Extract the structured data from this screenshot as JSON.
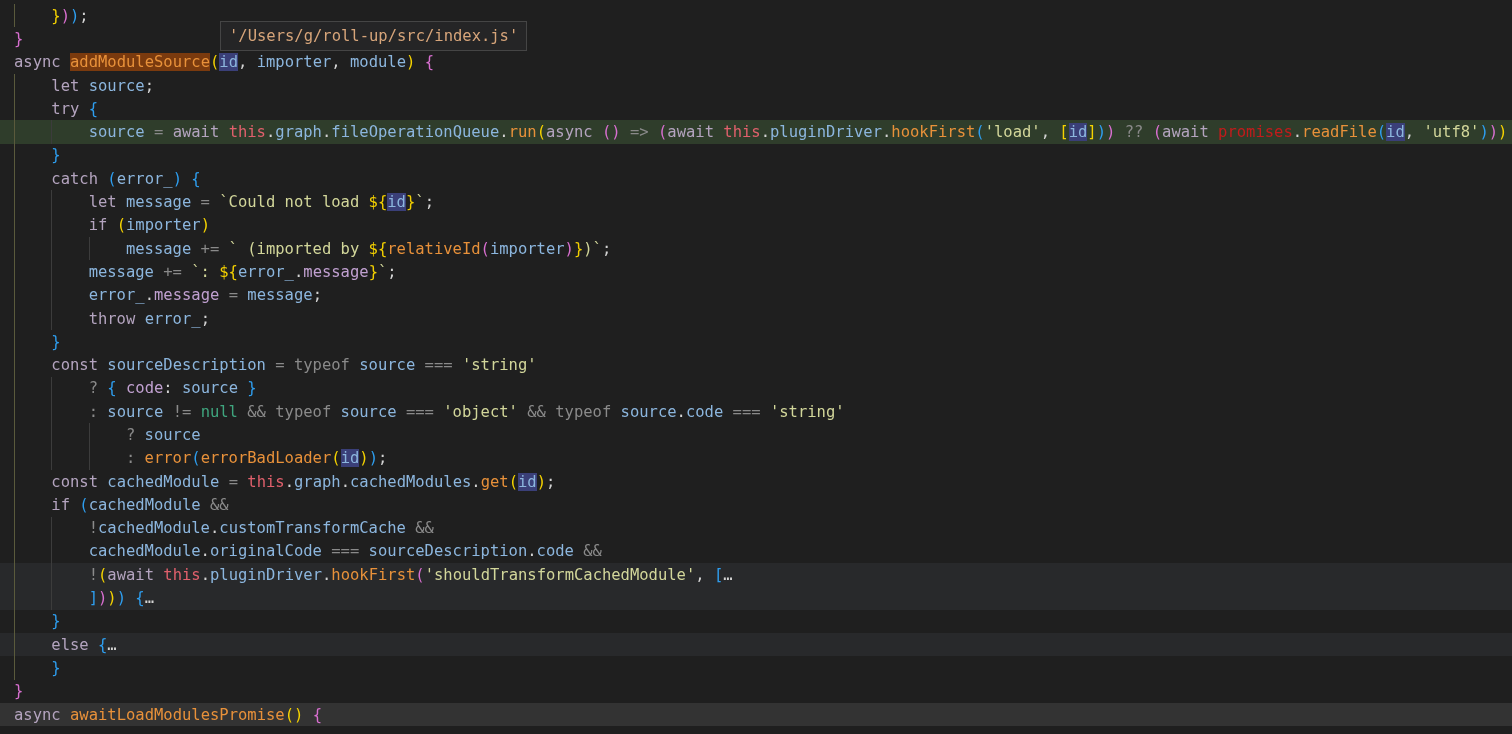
{
  "editor": {
    "tooltip": "'/Users/g/roll-up/src/index.js'",
    "lines": [
      {
        "kind": "normal",
        "tokens": [
          {
            "text": "    }",
            "kind": "p3"
          },
          {
            "text": ")",
            "kind": "p1"
          },
          {
            "text": ")",
            "kind": "p2"
          },
          {
            "text": ";",
            "kind": "punct"
          }
        ]
      },
      {
        "kind": "normal",
        "tokens": [
          {
            "text": "}",
            "kind": "p1"
          }
        ]
      },
      {
        "kind": "normal",
        "tokens": [
          {
            "text": "async ",
            "kind": "kw"
          },
          {
            "text": "addModuleSource",
            "kind": "fn",
            "highlighted": true
          },
          {
            "text": "(",
            "kind": "p3"
          },
          {
            "text": "id",
            "kind": "var",
            "highlighted": true
          },
          {
            "text": ", ",
            "kind": "punct"
          },
          {
            "text": "importer",
            "kind": "var"
          },
          {
            "text": ", ",
            "kind": "punct"
          },
          {
            "text": "module",
            "kind": "var"
          },
          {
            "text": ")",
            "kind": "p3"
          },
          {
            "text": " {",
            "kind": "p1"
          }
        ]
      },
      {
        "kind": "normal",
        "tokens": [
          {
            "text": "    let ",
            "kind": "kw"
          },
          {
            "text": "source",
            "kind": "var"
          },
          {
            "text": ";",
            "kind": "punct"
          }
        ]
      },
      {
        "kind": "normal",
        "tokens": [
          {
            "text": "    try ",
            "kind": "kw"
          },
          {
            "text": "{",
            "kind": "p2"
          }
        ]
      },
      {
        "kind": "changed",
        "tokens": [
          {
            "text": "        source",
            "kind": "var"
          },
          {
            "text": " = ",
            "kind": "op"
          },
          {
            "text": "await ",
            "kind": "kw"
          },
          {
            "text": "this",
            "kind": "this"
          },
          {
            "text": ".",
            "kind": "punct"
          },
          {
            "text": "graph",
            "kind": "var"
          },
          {
            "text": ".",
            "kind": "punct"
          },
          {
            "text": "fileOperationQueue",
            "kind": "var"
          },
          {
            "text": ".",
            "kind": "punct"
          },
          {
            "text": "run",
            "kind": "fn"
          },
          {
            "text": "(",
            "kind": "p3"
          },
          {
            "text": "async ",
            "kind": "kw"
          },
          {
            "text": "()",
            "kind": "p1"
          },
          {
            "text": " => ",
            "kind": "op"
          },
          {
            "text": "(",
            "kind": "p1"
          },
          {
            "text": "await ",
            "kind": "kw"
          },
          {
            "text": "this",
            "kind": "this"
          },
          {
            "text": ".",
            "kind": "punct"
          },
          {
            "text": "pluginDriver",
            "kind": "var"
          },
          {
            "text": ".",
            "kind": "punct"
          },
          {
            "text": "hookFirst",
            "kind": "fn"
          },
          {
            "text": "(",
            "kind": "p2"
          },
          {
            "text": "'load'",
            "kind": "str"
          },
          {
            "text": ", ",
            "kind": "punct"
          },
          {
            "text": "[",
            "kind": "p3"
          },
          {
            "text": "id",
            "kind": "var",
            "highlighted": true
          },
          {
            "text": "]",
            "kind": "p3"
          },
          {
            "text": ")",
            "kind": "p2"
          },
          {
            "text": ")",
            "kind": "p1"
          },
          {
            "text": " ?? ",
            "kind": "op"
          },
          {
            "text": "(",
            "kind": "p1"
          },
          {
            "text": "await ",
            "kind": "kw"
          },
          {
            "text": "promises",
            "kind": "global"
          },
          {
            "text": ".",
            "kind": "punct"
          },
          {
            "text": "readFile",
            "kind": "fn"
          },
          {
            "text": "(",
            "kind": "p2"
          },
          {
            "text": "id",
            "kind": "var",
            "highlighted": true
          },
          {
            "text": ", ",
            "kind": "punct"
          },
          {
            "text": "'utf8'",
            "kind": "str"
          },
          {
            "text": ")",
            "kind": "p2"
          },
          {
            "text": ")",
            "kind": "p1"
          },
          {
            "text": ")",
            "kind": "p3"
          }
        ]
      },
      {
        "kind": "normal",
        "tokens": [
          {
            "text": "    }",
            "kind": "p2"
          }
        ]
      },
      {
        "kind": "normal",
        "tokens": [
          {
            "text": "    catch ",
            "kind": "kw"
          },
          {
            "text": "(",
            "kind": "p2"
          },
          {
            "text": "error_",
            "kind": "var"
          },
          {
            "text": ")",
            "kind": "p2"
          },
          {
            "text": " {",
            "kind": "p2"
          }
        ]
      },
      {
        "kind": "normal",
        "tokens": [
          {
            "text": "        let ",
            "kind": "kw"
          },
          {
            "text": "message",
            "kind": "var"
          },
          {
            "text": " = ",
            "kind": "op"
          },
          {
            "text": "`Could not load ",
            "kind": "str"
          },
          {
            "text": "${",
            "kind": "tpl"
          },
          {
            "text": "id",
            "kind": "var",
            "highlighted": true
          },
          {
            "text": "}",
            "kind": "tpl"
          },
          {
            "text": "`",
            "kind": "str"
          },
          {
            "text": ";",
            "kind": "punct"
          }
        ]
      },
      {
        "kind": "normal",
        "tokens": [
          {
            "text": "        if ",
            "kind": "kw"
          },
          {
            "text": "(",
            "kind": "p3"
          },
          {
            "text": "importer",
            "kind": "var"
          },
          {
            "text": ")",
            "kind": "p3"
          }
        ]
      },
      {
        "kind": "normal",
        "tokens": [
          {
            "text": "            message",
            "kind": "var"
          },
          {
            "text": " += ",
            "kind": "op"
          },
          {
            "text": "` (imported by ",
            "kind": "str"
          },
          {
            "text": "${",
            "kind": "tpl"
          },
          {
            "text": "relativeId",
            "kind": "fn"
          },
          {
            "text": "(",
            "kind": "p1"
          },
          {
            "text": "importer",
            "kind": "var"
          },
          {
            "text": ")",
            "kind": "p1"
          },
          {
            "text": "}",
            "kind": "tpl"
          },
          {
            "text": ")`",
            "kind": "str"
          },
          {
            "text": ";",
            "kind": "punct"
          }
        ]
      },
      {
        "kind": "normal",
        "tokens": [
          {
            "text": "        message",
            "kind": "var"
          },
          {
            "text": " += ",
            "kind": "op"
          },
          {
            "text": "`: ",
            "kind": "str"
          },
          {
            "text": "${",
            "kind": "tpl"
          },
          {
            "text": "error_",
            "kind": "var"
          },
          {
            "text": ".",
            "kind": "punct"
          },
          {
            "text": "message",
            "kind": "prop"
          },
          {
            "text": "}",
            "kind": "tpl"
          },
          {
            "text": "`",
            "kind": "str"
          },
          {
            "text": ";",
            "kind": "punct"
          }
        ]
      },
      {
        "kind": "normal",
        "tokens": [
          {
            "text": "        error_",
            "kind": "var"
          },
          {
            "text": ".",
            "kind": "punct"
          },
          {
            "text": "message",
            "kind": "prop"
          },
          {
            "text": " = ",
            "kind": "op"
          },
          {
            "text": "message",
            "kind": "var"
          },
          {
            "text": ";",
            "kind": "punct"
          }
        ]
      },
      {
        "kind": "normal",
        "tokens": [
          {
            "text": "        throw ",
            "kind": "kw"
          },
          {
            "text": "error_",
            "kind": "var"
          },
          {
            "text": ";",
            "kind": "punct"
          }
        ]
      },
      {
        "kind": "normal",
        "tokens": [
          {
            "text": "    }",
            "kind": "p2"
          }
        ]
      },
      {
        "kind": "normal",
        "tokens": [
          {
            "text": "    const ",
            "kind": "kw"
          },
          {
            "text": "sourceDescription",
            "kind": "var"
          },
          {
            "text": " = typeof ",
            "kind": "op"
          },
          {
            "text": "source",
            "kind": "var"
          },
          {
            "text": " === ",
            "kind": "op"
          },
          {
            "text": "'string'",
            "kind": "str"
          }
        ]
      },
      {
        "kind": "normal",
        "tokens": [
          {
            "text": "        ? ",
            "kind": "op"
          },
          {
            "text": "{ ",
            "kind": "p2"
          },
          {
            "text": "code",
            "kind": "prop"
          },
          {
            "text": ": ",
            "kind": "punct"
          },
          {
            "text": "source",
            "kind": "var"
          },
          {
            "text": " }",
            "kind": "p2"
          }
        ]
      },
      {
        "kind": "normal",
        "tokens": [
          {
            "text": "        : ",
            "kind": "op"
          },
          {
            "text": "source",
            "kind": "var"
          },
          {
            "text": " != ",
            "kind": "op"
          },
          {
            "text": "null",
            "kind": "null"
          },
          {
            "text": " && typeof ",
            "kind": "op"
          },
          {
            "text": "source",
            "kind": "var"
          },
          {
            "text": " === ",
            "kind": "op"
          },
          {
            "text": "'object'",
            "kind": "str"
          },
          {
            "text": " && typeof ",
            "kind": "op"
          },
          {
            "text": "source",
            "kind": "var"
          },
          {
            "text": ".",
            "kind": "punct"
          },
          {
            "text": "code",
            "kind": "var"
          },
          {
            "text": " === ",
            "kind": "op"
          },
          {
            "text": "'string'",
            "kind": "str"
          }
        ]
      },
      {
        "kind": "normal",
        "tokens": [
          {
            "text": "            ? ",
            "kind": "op"
          },
          {
            "text": "source",
            "kind": "var"
          }
        ]
      },
      {
        "kind": "normal",
        "tokens": [
          {
            "text": "            : ",
            "kind": "op"
          },
          {
            "text": "error",
            "kind": "fn"
          },
          {
            "text": "(",
            "kind": "p2"
          },
          {
            "text": "errorBadLoader",
            "kind": "fn"
          },
          {
            "text": "(",
            "kind": "p3"
          },
          {
            "text": "id",
            "kind": "var",
            "highlighted": true
          },
          {
            "text": ")",
            "kind": "p3"
          },
          {
            "text": ")",
            "kind": "p2"
          },
          {
            "text": ";",
            "kind": "punct"
          }
        ]
      },
      {
        "kind": "normal",
        "tokens": [
          {
            "text": "    const ",
            "kind": "kw"
          },
          {
            "text": "cachedModule",
            "kind": "var"
          },
          {
            "text": " = ",
            "kind": "op"
          },
          {
            "text": "this",
            "kind": "this"
          },
          {
            "text": ".",
            "kind": "punct"
          },
          {
            "text": "graph",
            "kind": "var"
          },
          {
            "text": ".",
            "kind": "punct"
          },
          {
            "text": "cachedModules",
            "kind": "var"
          },
          {
            "text": ".",
            "kind": "punct"
          },
          {
            "text": "get",
            "kind": "fn"
          },
          {
            "text": "(",
            "kind": "p3"
          },
          {
            "text": "id",
            "kind": "var",
            "highlighted": true
          },
          {
            "text": ")",
            "kind": "p3"
          },
          {
            "text": ";",
            "kind": "punct"
          }
        ]
      },
      {
        "kind": "normal",
        "tokens": [
          {
            "text": "    if ",
            "kind": "kw"
          },
          {
            "text": "(",
            "kind": "p2"
          },
          {
            "text": "cachedModule",
            "kind": "var"
          },
          {
            "text": " &&",
            "kind": "op"
          }
        ]
      },
      {
        "kind": "normal",
        "tokens": [
          {
            "text": "        !",
            "kind": "op"
          },
          {
            "text": "cachedModule",
            "kind": "var"
          },
          {
            "text": ".",
            "kind": "punct"
          },
          {
            "text": "customTransformCache",
            "kind": "var"
          },
          {
            "text": " &&",
            "kind": "op"
          }
        ]
      },
      {
        "kind": "normal",
        "tokens": [
          {
            "text": "        cachedModule",
            "kind": "var"
          },
          {
            "text": ".",
            "kind": "punct"
          },
          {
            "text": "originalCode",
            "kind": "var"
          },
          {
            "text": " === ",
            "kind": "op"
          },
          {
            "text": "sourceDescription",
            "kind": "var"
          },
          {
            "text": ".",
            "kind": "punct"
          },
          {
            "text": "code",
            "kind": "var"
          },
          {
            "text": " &&",
            "kind": "op"
          }
        ]
      },
      {
        "kind": "folded",
        "tokens": [
          {
            "text": "        !",
            "kind": "op"
          },
          {
            "text": "(",
            "kind": "p3"
          },
          {
            "text": "await ",
            "kind": "kw"
          },
          {
            "text": "this",
            "kind": "this"
          },
          {
            "text": ".",
            "kind": "punct"
          },
          {
            "text": "pluginDriver",
            "kind": "var"
          },
          {
            "text": ".",
            "kind": "punct"
          },
          {
            "text": "hookFirst",
            "kind": "fn"
          },
          {
            "text": "(",
            "kind": "p1"
          },
          {
            "text": "'shouldTransformCachedModule'",
            "kind": "str"
          },
          {
            "text": ", ",
            "kind": "punct"
          },
          {
            "text": "[",
            "kind": "p2"
          },
          {
            "text": "…",
            "kind": "punct"
          }
        ]
      },
      {
        "kind": "folded",
        "tokens": [
          {
            "text": "        ]",
            "kind": "p2"
          },
          {
            "text": ")",
            "kind": "p1"
          },
          {
            "text": ")",
            "kind": "p3"
          },
          {
            "text": ")",
            "kind": "p2"
          },
          {
            "text": " {",
            "kind": "p2"
          },
          {
            "text": "…",
            "kind": "punct"
          }
        ]
      },
      {
        "kind": "normal",
        "tokens": [
          {
            "text": "    }",
            "kind": "p2"
          }
        ]
      },
      {
        "kind": "folded",
        "tokens": [
          {
            "text": "    else ",
            "kind": "kw"
          },
          {
            "text": "{",
            "kind": "p2"
          },
          {
            "text": "…",
            "kind": "punct"
          }
        ]
      },
      {
        "kind": "normal",
        "tokens": [
          {
            "text": "    }",
            "kind": "p2"
          }
        ]
      },
      {
        "kind": "normal",
        "tokens": [
          {
            "text": "}",
            "kind": "p1"
          }
        ]
      },
      {
        "kind": "current",
        "tokens": [
          {
            "text": "async ",
            "kind": "kw"
          },
          {
            "text": "awaitLoadModulesPromise",
            "kind": "fn"
          },
          {
            "text": "()",
            "kind": "p3"
          },
          {
            "text": " {",
            "kind": "p1"
          }
        ]
      }
    ]
  }
}
